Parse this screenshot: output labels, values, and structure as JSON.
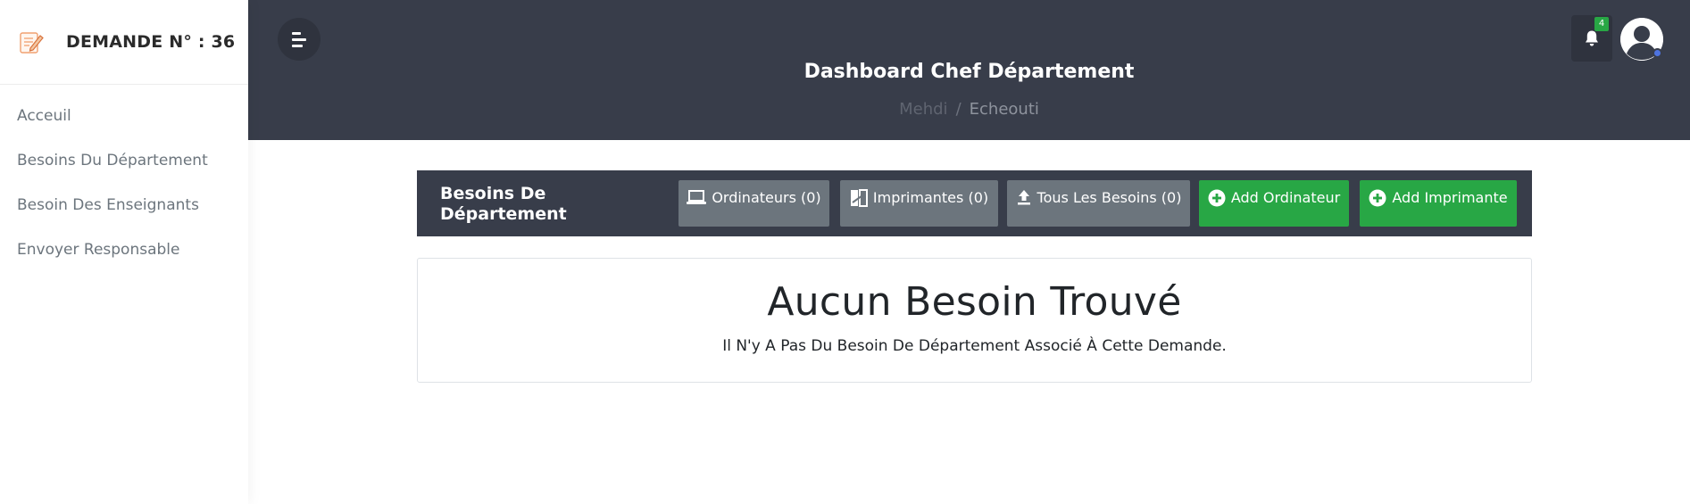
{
  "sidebar": {
    "brand_icon": "edit-note-icon",
    "brand_title": "DEMANDE N° : 36",
    "items": [
      {
        "label": "Acceuil"
      },
      {
        "label": "Besoins Du Département"
      },
      {
        "label": "Besoin Des Enseignants"
      },
      {
        "label": "Envoyer Responsable"
      }
    ]
  },
  "header": {
    "title": "Dashboard Chef Département",
    "breadcrumb": [
      "Mehdi",
      "/",
      "Echeouti"
    ],
    "notification_count": "4",
    "icons": [
      "menu-toggle-icon",
      "bell-icon",
      "user-avatar-icon"
    ]
  },
  "toolbar": {
    "title": "Besoins De Département",
    "buttons": [
      {
        "label": "Ordinateurs (0)",
        "icon": "laptop-icon",
        "style": "secondary"
      },
      {
        "label": "Imprimantes (0)",
        "icon": "printer-icon",
        "style": "secondary"
      },
      {
        "label": "Tous Les Besoins (0)",
        "icon": "upload-icon",
        "style": "secondary"
      },
      {
        "label": "Add Ordinateur",
        "icon": "plus-circle-icon",
        "style": "success"
      },
      {
        "label": "Add Imprimante",
        "icon": "plus-circle-icon",
        "style": "success"
      }
    ]
  },
  "empty_state": {
    "title": "Aucun Besoin Trouvé",
    "message": "Il N'y A Pas Du Besoin De Département Associé À Cette Demande."
  },
  "colors": {
    "header_bg": "#383d4a",
    "button_secondary": "#6c757d",
    "button_success": "#28a745",
    "badge": "#28a745",
    "status_dot": "#4e73df"
  }
}
